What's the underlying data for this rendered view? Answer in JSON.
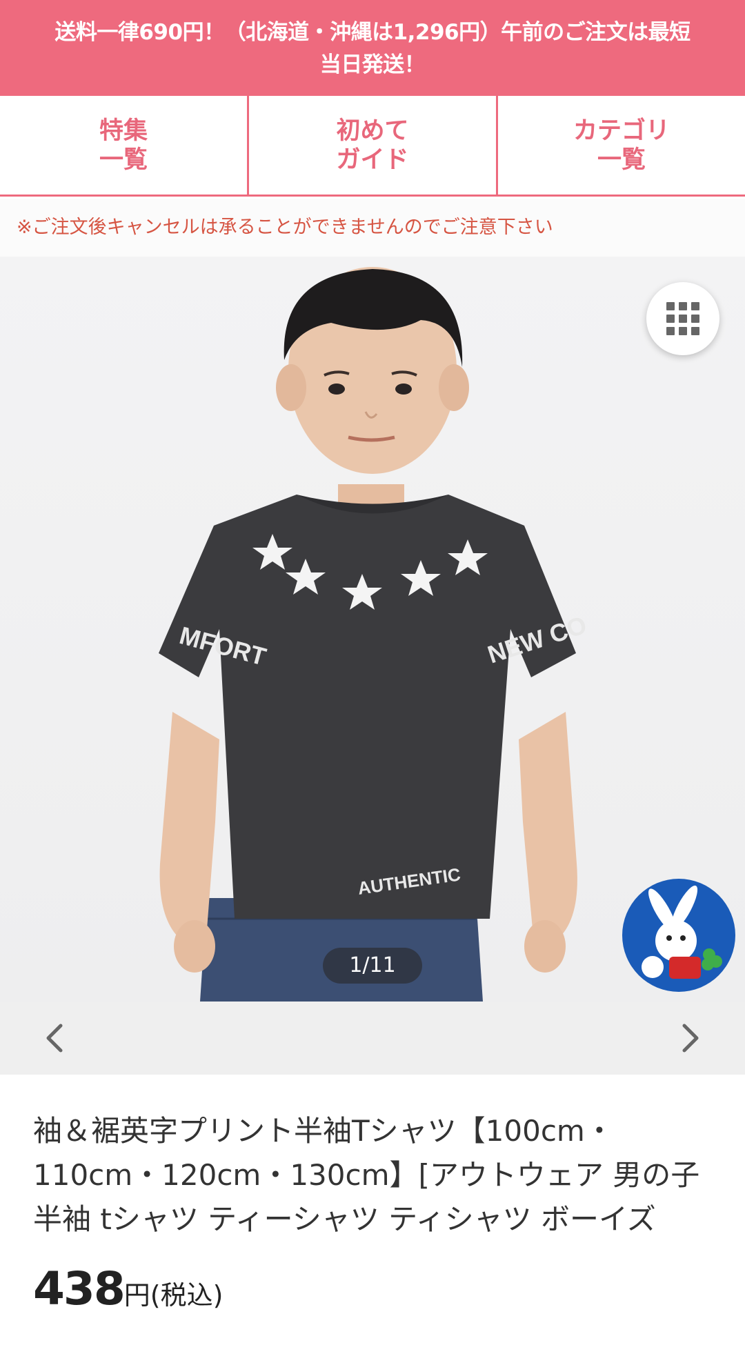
{
  "banner": {
    "line1": "送料一律690円！（北海道・沖縄は1,296円）午前のご注文は最短",
    "line2": "当日発送！"
  },
  "nav": {
    "items": [
      {
        "line1": "特集",
        "line2": "一覧"
      },
      {
        "line1": "初めて",
        "line2": "ガイド"
      },
      {
        "line1": "カテゴリ",
        "line2": "一覧"
      }
    ]
  },
  "notice": "※ご注文後キャンセルは承ることができませんのでご注意下さい",
  "gallery": {
    "counter": "1/11",
    "icons": {
      "grid": "grid-icon",
      "prev": "chevron-left-icon",
      "next": "chevron-right-icon",
      "mascot": "rabbit-mascot-icon"
    },
    "shirt_prints": {
      "sleeve_left": "MFORT",
      "sleeve_right": "NEW CO",
      "hem": "AUTHENTIC"
    }
  },
  "product": {
    "title": "袖＆裾英字プリント半袖Tシャツ【100cm・110cm・120cm・130cm】[アウトウェア 男の子 半袖 tシャツ ティーシャツ ティシャツ ボーイズ",
    "price": "438",
    "price_unit": "円",
    "price_tax": "(税込)"
  },
  "colors": {
    "brand_pink": "#ee6a7e",
    "notice_red": "#d65543",
    "shirt": "#3b3b3e",
    "mascot_blue": "#1a5bb8"
  }
}
